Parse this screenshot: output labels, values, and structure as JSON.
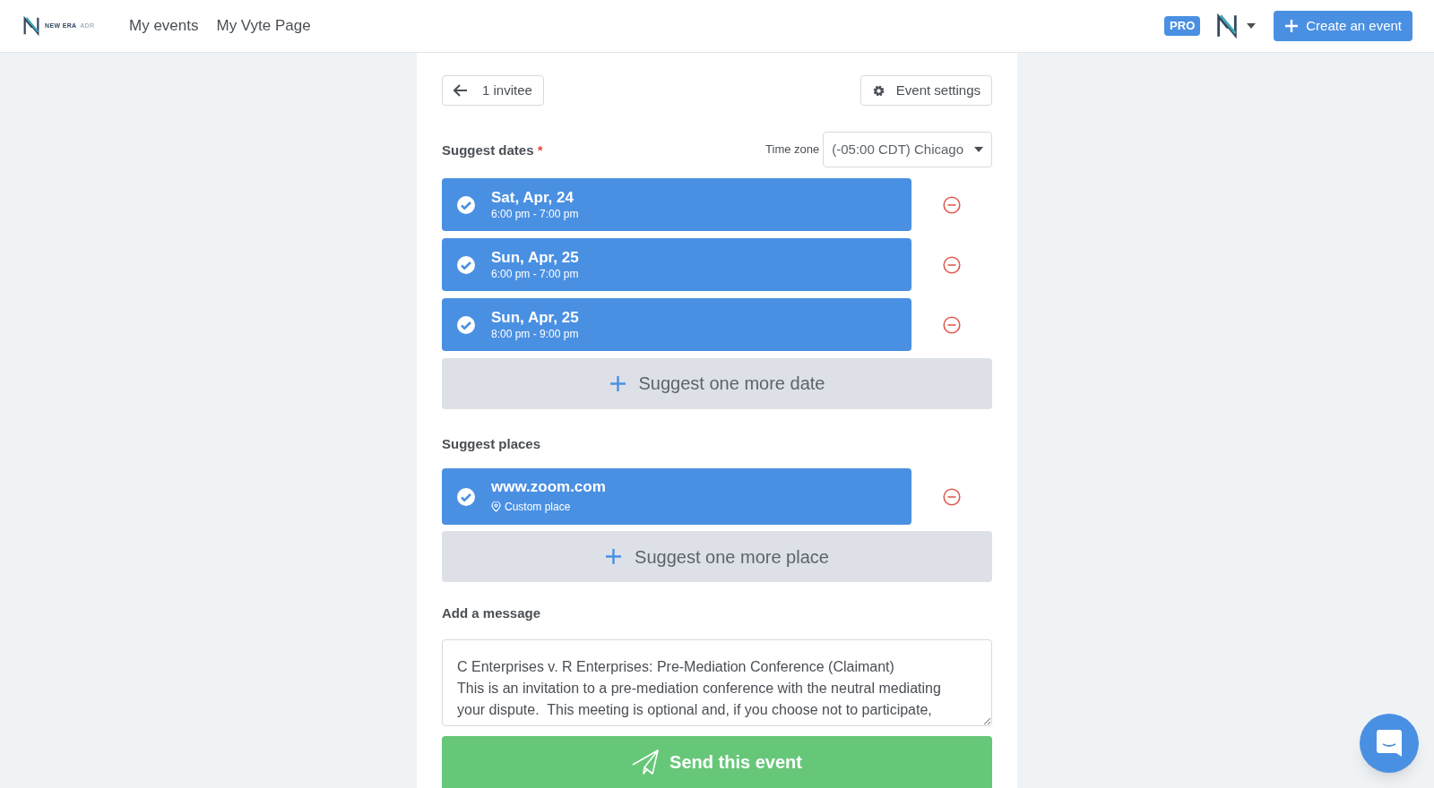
{
  "header": {
    "logo_text": "NEW ERA",
    "logo_suffix": "ADR",
    "nav": [
      {
        "label": "My events"
      },
      {
        "label": "My Vyte Page"
      }
    ],
    "badge": "PRO",
    "create_button": "Create an event"
  },
  "toolbar": {
    "back_label": "1 invitee",
    "settings_label": "Event settings"
  },
  "dates": {
    "title": "Suggest dates",
    "required_mark": "*",
    "timezone_label": "Time zone",
    "timezone_value": "(-05:00 CDT) Chicago",
    "items": [
      {
        "day": "Sat, Apr, 24",
        "time": "6:00 pm - 7:00 pm",
        "checked": true
      },
      {
        "day": "Sun, Apr, 25",
        "time": "6:00 pm - 7:00 pm",
        "checked": true
      },
      {
        "day": "Sun, Apr, 25",
        "time": "8:00 pm - 9:00 pm",
        "checked": true
      }
    ],
    "add_label": "Suggest one more date"
  },
  "places": {
    "title": "Suggest places",
    "items": [
      {
        "name": "www.zoom.com",
        "detail": "Custom place",
        "checked": true
      }
    ],
    "add_label": "Suggest one more place"
  },
  "message": {
    "title": "Add a message",
    "value": "C Enterprises v. R Enterprises: Pre-Mediation Conference (Claimant)\nThis is an invitation to a pre-mediation conference with the neutral mediating\nyour dispute.  This meeting is optional and, if you choose not to participate,"
  },
  "send_button": "Send this event"
}
